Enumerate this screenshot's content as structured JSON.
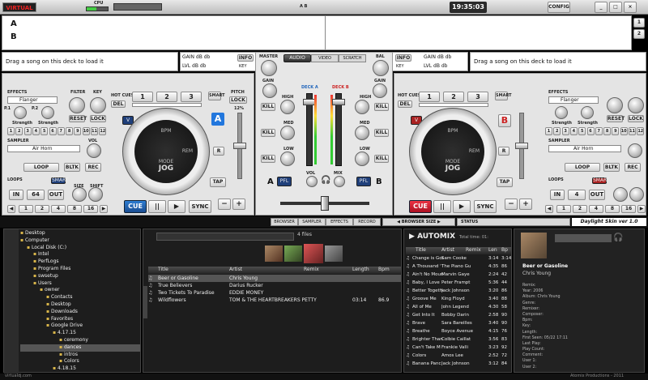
{
  "app": {
    "logo": "VIRTUAL DJ",
    "cpu_label": "CPU",
    "clock": "19:35:03",
    "config": "CONFIG",
    "ab_label": "A B",
    "cpu_level": 0.45
  },
  "waves": {
    "labels_a": "A",
    "labels_b": "B",
    "num1": "1",
    "num2": "2"
  },
  "deckA": {
    "drag": "Drag a song on this deck to load it",
    "gain": "GAIN dB db",
    "lvl": "LVL dB db",
    "key": "KEY",
    "info": "INFO",
    "effects": "EFFECTS",
    "effect": "Flanger",
    "p1": "P.1",
    "p2": "P.2",
    "bpm_label": "Strength",
    "bpm2": "Strength",
    "filter": "FILTER",
    "key2": "KEY",
    "reset": "RESET",
    "lock": "LOCK",
    "sampler": "SAMPLER",
    "sample": "Air Horn",
    "vol": "VOL",
    "bltk": "BLTK",
    "rec": "REC",
    "loop": "LOOP",
    "loops": "LOOPS",
    "smart": "SMART",
    "size": "SIZE",
    "shift": "SHIFT",
    "in": "IN",
    "loopval": "64",
    "out": "OUT",
    "hotcues": "HOT CUES",
    "del": "DEL",
    "hc1": "1",
    "hc2": "2",
    "hc3": "3",
    "smart2": "SMART",
    "pitch": "PITCH",
    "lock2": "LOCK",
    "pct": "12%",
    "v": "V",
    "letter": "A",
    "r": "R",
    "tap": "TAP",
    "bpm": "BPM",
    "mode": "MODE",
    "jog": "JOG",
    "rem": "REM",
    "cue": "CUE",
    "play": "▶",
    "pause": "||",
    "sync": "SYNC",
    "minus": "−",
    "plus": "+",
    "nums": [
      "1",
      "2",
      "3",
      "4",
      "5",
      "6",
      "7",
      "8",
      "9",
      "10",
      "11",
      "12"
    ],
    "loopnums": [
      "1",
      "2",
      "4",
      "8",
      "16"
    ]
  },
  "deckB": {
    "drag": "Drag a song on this deck to load it",
    "gain": "GAIN dB db",
    "lvl": "LVL dB db",
    "key": "KEY",
    "info": "INFO",
    "letter": "B",
    "loopval": "4",
    "v": "V"
  },
  "mixer": {
    "master": "MASTER",
    "bal": "BAL",
    "gain": "GAIN",
    "tab_audio": "AUDIO",
    "tab_video": "VIDEO",
    "tab_scratch": "SCRATCH",
    "deck_a": "DECK A",
    "deck_b": "DECK B",
    "high": "HIGH",
    "med": "MED",
    "low": "LOW",
    "kill": "KILL",
    "vol": "VOL",
    "mix": "MIX",
    "pfl": "PFL",
    "a": "A",
    "b": "B"
  },
  "bottomtabs": {
    "browser": "BROWSER",
    "sampler": "SAMPLER",
    "effects": "EFFECTS",
    "record": "RECORD",
    "browser_size": "BROWSER SIZE",
    "status": "STATUS",
    "skin": "Daylight Skin ver 1.0"
  },
  "tree": [
    {
      "label": "Desktop",
      "indent": 0
    },
    {
      "label": "Computer",
      "indent": 0
    },
    {
      "label": "Local Disk (C:)",
      "indent": 1
    },
    {
      "label": "Intel",
      "indent": 2
    },
    {
      "label": "PerfLogs",
      "indent": 2
    },
    {
      "label": "Program Files",
      "indent": 2
    },
    {
      "label": "swsetup",
      "indent": 2
    },
    {
      "label": "Users",
      "indent": 2
    },
    {
      "label": "owner",
      "indent": 3
    },
    {
      "label": "Contacts",
      "indent": 4
    },
    {
      "label": "Desktop",
      "indent": 4
    },
    {
      "label": "Downloads",
      "indent": 4
    },
    {
      "label": "Favorites",
      "indent": 4
    },
    {
      "label": "Google Drive",
      "indent": 4
    },
    {
      "label": "4.17.15",
      "indent": 5
    },
    {
      "label": "ceremony",
      "indent": 6
    },
    {
      "label": "dances",
      "indent": 6
    },
    {
      "label": "intros",
      "indent": 6
    },
    {
      "label": "Colors",
      "indent": 6
    },
    {
      "label": "4.18.15",
      "indent": 5
    }
  ],
  "browser": {
    "files": "4 files",
    "cols": {
      "title": "Title",
      "artist": "Artist",
      "remix": "Remix",
      "length": "Length",
      "bpm": "Bpm"
    },
    "rows": [
      {
        "title": "Beer or Gasoline",
        "artist": "Chris Young",
        "remix": "",
        "length": "",
        "bpm": ""
      },
      {
        "title": "True Believers",
        "artist": "Darius Rucker",
        "remix": "",
        "length": "",
        "bpm": ""
      },
      {
        "title": "Two Tickets To Paradise",
        "artist": "EDDIE MONEY",
        "remix": "",
        "length": "",
        "bpm": ""
      },
      {
        "title": "Wildflowers",
        "artist": "TOM & THE HEARTBREAKERS PETTY",
        "remix": "",
        "length": "03:14",
        "bpm": "86.9"
      }
    ]
  },
  "automix": {
    "title": "AUTOMIX",
    "total": "Total time: 01:",
    "cols": {
      "title": "Title",
      "artist": "Artist",
      "remix": "Remix",
      "len": "Len",
      "bpm": "Bp"
    },
    "rows": [
      {
        "t": "Change is Gon",
        "a": "Sam Cooke",
        "l": "3:14",
        "b": "3:14"
      },
      {
        "t": "A Thousand '",
        "a": "The Piano Gu",
        "l": "4:35",
        "b": "86"
      },
      {
        "t": "Ain't No Moun",
        "a": "Marvin Gaye",
        "l": "2:24",
        "b": "42"
      },
      {
        "t": "Baby, I Love",
        "a": "Peter Frampt",
        "l": "5:36",
        "b": "44"
      },
      {
        "t": "Better Togethe",
        "a": "Jack Johnson",
        "l": "3:20",
        "b": "86"
      },
      {
        "t": "Groove Me",
        "a": "King Floyd",
        "l": "3:40",
        "b": "88"
      },
      {
        "t": "All of Me",
        "a": "John Legend",
        "l": "4:30",
        "b": "58"
      },
      {
        "t": "Get Into It",
        "a": "Bobby Darin",
        "l": "2:58",
        "b": "90"
      },
      {
        "t": "Brave",
        "a": "Sara Bareilles",
        "l": "3:40",
        "b": "90"
      },
      {
        "t": "Breathe",
        "a": "Boyce Avenue",
        "l": "4:15",
        "b": "76"
      },
      {
        "t": "Brighter Than",
        "a": "Colbie Caillat",
        "l": "3:56",
        "b": "83"
      },
      {
        "t": "Can't Take M",
        "a": "Frankie Valli",
        "l": "3:23",
        "b": "92"
      },
      {
        "t": "Colors",
        "a": "Amos Lee",
        "l": "2:52",
        "b": "72"
      },
      {
        "t": "Banana Panc",
        "a": "Jack Johnson",
        "l": "3:12",
        "b": "84"
      }
    ]
  },
  "info": {
    "song": "Beer or Gasoline",
    "artist": "Chris Young",
    "fields": [
      "Remix:",
      "Year: 2006",
      "Album: Chris Young",
      "Genre:",
      "Remixer:",
      "Composer:",
      "Bpm:",
      "Key:",
      "Length:",
      "First Seen: 05/22 17:11",
      "Last Play:",
      "Play Count:",
      "Comment:",
      "User 1:",
      "User 2:"
    ]
  },
  "footer": {
    "left": "virtualdj.com",
    "right": "Atomix Productions - 2011"
  }
}
